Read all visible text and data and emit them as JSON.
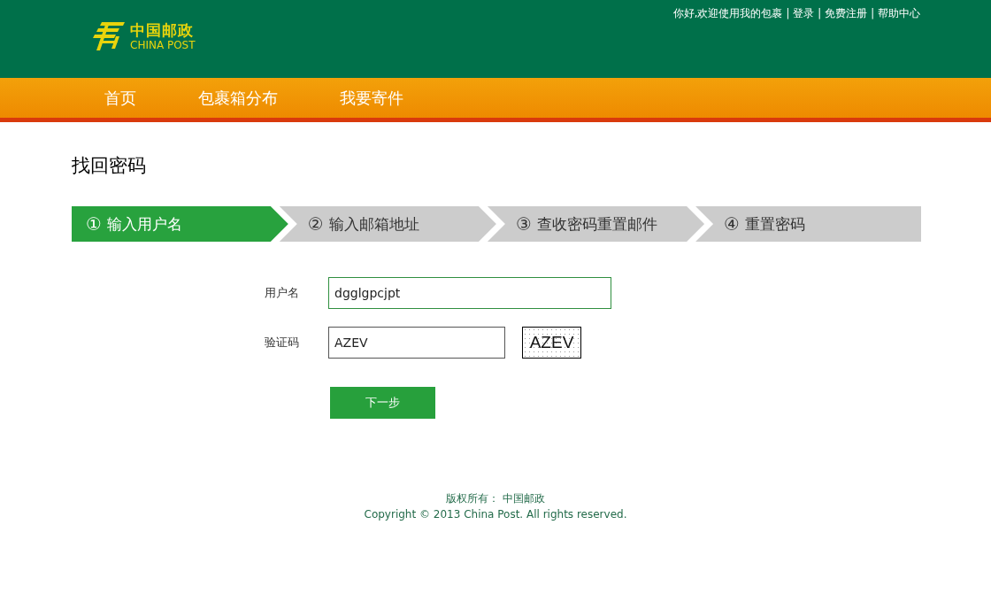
{
  "header": {
    "logo": {
      "cn": "中国邮政",
      "en": "CHINA POST"
    },
    "top_bar": {
      "greeting": "你好,欢迎使用我的包裹",
      "separator": "|",
      "links": [
        "登录",
        "免费注册",
        "帮助中心"
      ]
    }
  },
  "nav": {
    "items": [
      {
        "label": "首页"
      },
      {
        "label": "包裹箱分布"
      },
      {
        "label": "我要寄件"
      }
    ]
  },
  "page_title": "找回密码",
  "steps": [
    {
      "number": "①",
      "label": "输入用户名",
      "selected": true
    },
    {
      "number": "②",
      "label": "输入邮箱地址",
      "selected": false
    },
    {
      "number": "③",
      "label": "查收密码重置邮件",
      "selected": false
    },
    {
      "number": "④",
      "label": "重置密码",
      "selected": false
    }
  ],
  "form": {
    "fields": [
      {
        "kind": "text",
        "label": "用户名",
        "value": "dgglgpcjpt",
        "focused": true
      },
      {
        "kind": "captcha",
        "label": "验证码",
        "value": "AZEV",
        "focused": false,
        "captcha_text": "AZEV"
      }
    ],
    "submit": "下一步"
  },
  "footer": {
    "rights": "版权所有： 中国邮政",
    "copyright": "Copyright © 2013 China Post. All rights reserved."
  }
}
